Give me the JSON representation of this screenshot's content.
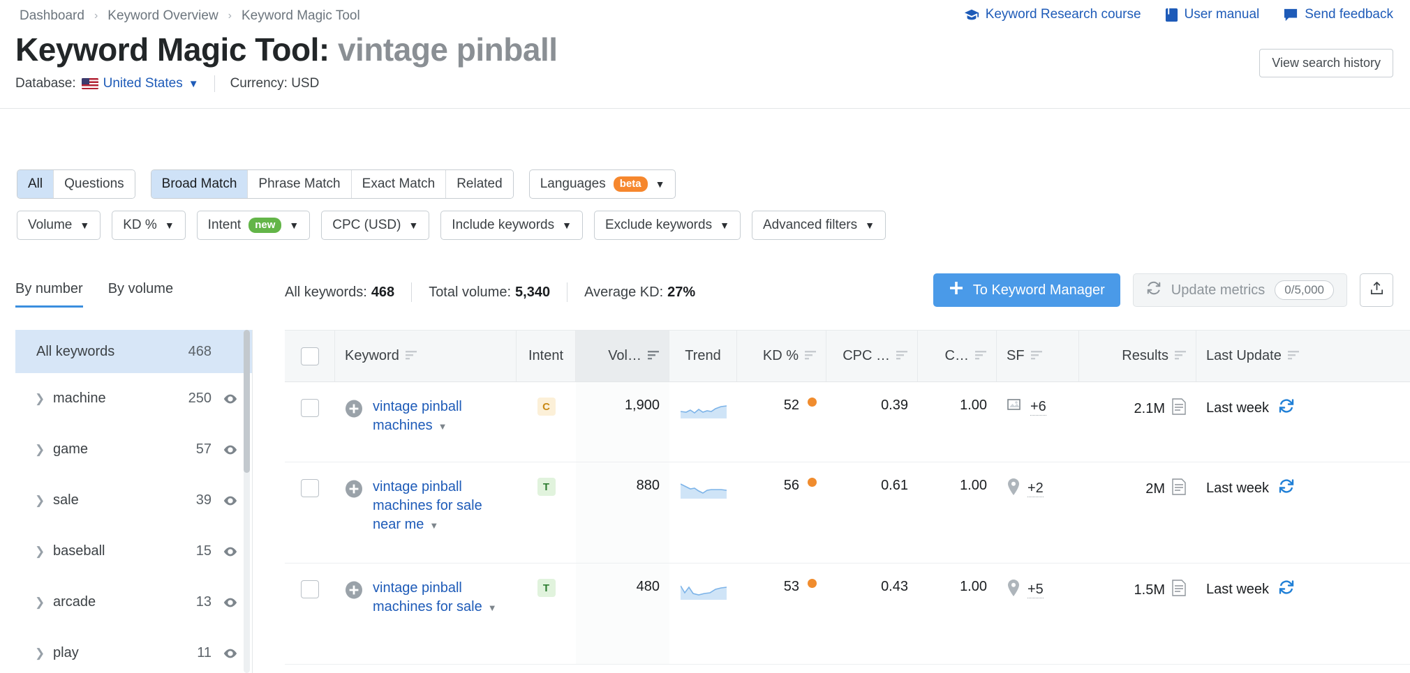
{
  "breadcrumb": {
    "items": [
      "Dashboard",
      "Keyword Overview",
      "Keyword Magic Tool"
    ],
    "separator": "›"
  },
  "toplinks": [
    {
      "label": "Keyword Research course",
      "icon": "graduation-cap-icon"
    },
    {
      "label": "User manual",
      "icon": "book-icon"
    },
    {
      "label": "Send feedback",
      "icon": "speech-bubble-icon"
    }
  ],
  "header": {
    "title_prefix": "Keyword Magic Tool:",
    "query": "vintage pinball",
    "history_button": "View search history",
    "database_label": "Database:",
    "database_value": "United States",
    "currency_label": "Currency: USD"
  },
  "match_tabs": {
    "group1": [
      {
        "label": "All",
        "active": true
      },
      {
        "label": "Questions",
        "active": false
      }
    ],
    "group2": [
      {
        "label": "Broad Match",
        "active": true
      },
      {
        "label": "Phrase Match",
        "active": false
      },
      {
        "label": "Exact Match",
        "active": false
      },
      {
        "label": "Related",
        "active": false
      }
    ],
    "languages": {
      "label": "Languages",
      "badge": "beta"
    }
  },
  "filters": [
    {
      "label": "Volume",
      "badge": null
    },
    {
      "label": "KD %",
      "badge": null
    },
    {
      "label": "Intent",
      "badge": "new"
    },
    {
      "label": "CPC (USD)",
      "badge": null
    },
    {
      "label": "Include keywords",
      "badge": null
    },
    {
      "label": "Exclude keywords",
      "badge": null
    },
    {
      "label": "Advanced filters",
      "badge": null
    }
  ],
  "group_tabs": [
    {
      "label": "By number",
      "active": true
    },
    {
      "label": "By volume",
      "active": false
    }
  ],
  "summary": {
    "all_keywords_label": "All keywords:",
    "all_keywords_value": "468",
    "total_volume_label": "Total volume:",
    "total_volume_value": "5,340",
    "average_kd_label": "Average KD:",
    "average_kd_value": "27%"
  },
  "actions": {
    "to_keyword_manager": "To Keyword Manager",
    "update_metrics": "Update metrics",
    "update_metrics_count": "0/5,000",
    "export_icon": "export-icon"
  },
  "sidebar": {
    "header": {
      "label": "All keywords",
      "count": "468"
    },
    "items": [
      {
        "label": "machine",
        "count": "250"
      },
      {
        "label": "game",
        "count": "57"
      },
      {
        "label": "sale",
        "count": "39"
      },
      {
        "label": "baseball",
        "count": "15"
      },
      {
        "label": "arcade",
        "count": "13"
      },
      {
        "label": "play",
        "count": "11"
      }
    ]
  },
  "table": {
    "columns": [
      {
        "key": "checkbox",
        "label": "",
        "sortable": false
      },
      {
        "key": "keyword",
        "label": "Keyword",
        "sortable": true
      },
      {
        "key": "intent",
        "label": "Intent",
        "sortable": false
      },
      {
        "key": "volume",
        "label": "Vol…",
        "sortable": true,
        "sorted": true
      },
      {
        "key": "trend",
        "label": "Trend",
        "sortable": false
      },
      {
        "key": "kd",
        "label": "KD %",
        "sortable": true
      },
      {
        "key": "cpc",
        "label": "CPC …",
        "sortable": true
      },
      {
        "key": "com",
        "label": "C…",
        "sortable": true
      },
      {
        "key": "sf",
        "label": "SF",
        "sortable": true
      },
      {
        "key": "results",
        "label": "Results",
        "sortable": true
      },
      {
        "key": "lastupdate",
        "label": "Last Update",
        "sortable": true
      }
    ],
    "rows": [
      {
        "keyword": "vintage pinball machines",
        "intent": "C",
        "volume": "1,900",
        "kd": "52",
        "kd_color": "#f08c2e",
        "cpc": "0.39",
        "com": "1.00",
        "sf_icon": "image-icon",
        "sf_more": "+6",
        "results": "2.1M",
        "last_update": "Last week"
      },
      {
        "keyword": "vintage pinball machines for sale near me",
        "intent": "T",
        "volume": "880",
        "kd": "56",
        "kd_color": "#f08c2e",
        "cpc": "0.61",
        "com": "1.00",
        "sf_icon": "map-pin-icon",
        "sf_more": "+2",
        "results": "2M",
        "last_update": "Last week"
      },
      {
        "keyword": "vintage pinball machines for sale",
        "intent": "T",
        "volume": "480",
        "kd": "53",
        "kd_color": "#f08c2e",
        "cpc": "0.43",
        "com": "1.00",
        "sf_icon": "map-pin-icon",
        "sf_more": "+5",
        "results": "1.5M",
        "last_update": "Last week"
      }
    ]
  },
  "colors": {
    "link": "#1e5bb8",
    "primary": "#4a9ae8",
    "active_tab": "#cfe2f7",
    "beta": "#f6872d",
    "new": "#63b548"
  }
}
